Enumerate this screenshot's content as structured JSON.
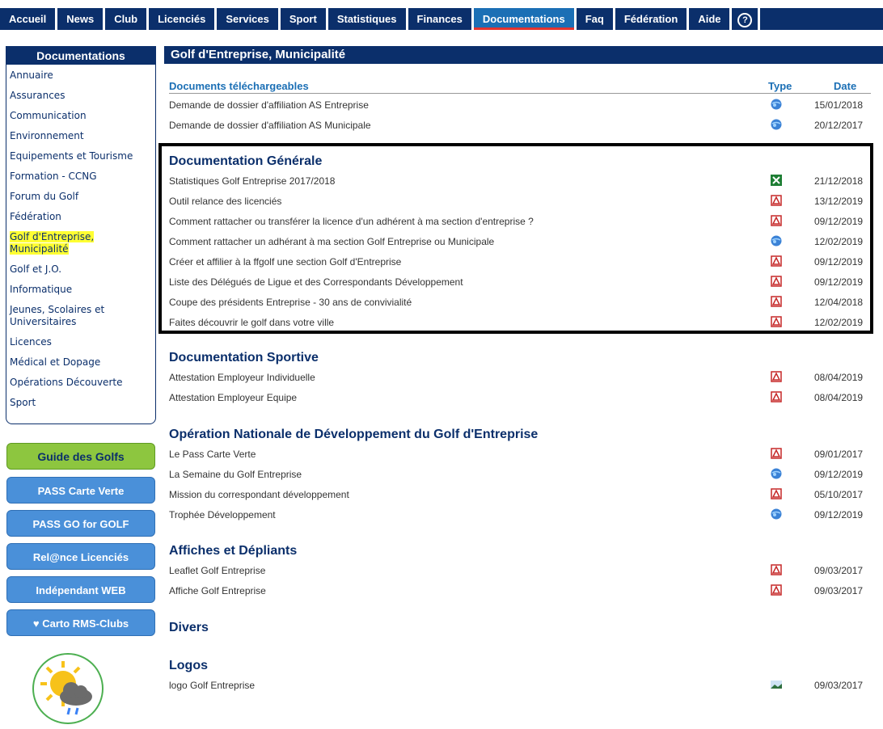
{
  "nav": {
    "items": [
      "Accueil",
      "News",
      "Club",
      "Licenciés",
      "Services",
      "Sport",
      "Statistiques",
      "Finances",
      "Documentations",
      "Faq",
      "Fédération",
      "Aide"
    ],
    "active_index": 8,
    "help_glyph": "?"
  },
  "sidebar": {
    "title": "Documentations",
    "items": [
      "Annuaire",
      "Assurances",
      "Communication",
      "Environnement",
      "Equipements et Tourisme",
      "Formation - CCNG",
      "Forum du Golf",
      "Fédération",
      "Golf d'Entreprise, Municipalité",
      "Golf et J.O.",
      "Informatique",
      "Jeunes, Scolaires et Universitaires",
      "Licences",
      "Médical et Dopage",
      "Opérations Découverte",
      "Sport"
    ],
    "highlighted_index": 8,
    "buttons": [
      "Guide des Golfs",
      "PASS Carte Verte",
      "PASS GO for GOLF",
      "Rel@nce Licenciés",
      "Indépendant WEB",
      "♥ Carto RMS-Clubs"
    ]
  },
  "main": {
    "title": "Golf d'Entreprise, Municipalité",
    "columns": {
      "title": "Documents téléchargeables",
      "type": "Type",
      "date": "Date"
    },
    "downloads": [
      {
        "label": "Demande de dossier d'affiliation AS Entreprise",
        "type": "web",
        "date": "15/01/2018"
      },
      {
        "label": "Demande de dossier d'affiliation AS Municipale",
        "type": "web",
        "date": "20/12/2017"
      }
    ],
    "sections": [
      {
        "title": "Documentation Générale",
        "rows": [
          {
            "label": "Statistiques Golf Entreprise 2017/2018",
            "type": "excel",
            "date": "21/12/2018"
          },
          {
            "label": "Outil relance des licenciés",
            "type": "pdf",
            "date": "13/12/2019"
          },
          {
            "label": "Comment rattacher ou transférer la licence d'un adhérent à ma section d'entreprise ?",
            "type": "pdf",
            "date": "09/12/2019"
          },
          {
            "label": "Comment rattacher un adhérant à ma section Golf Entreprise ou Municipale",
            "type": "web",
            "date": "12/02/2019"
          },
          {
            "label": "Créer et affilier à la ffgolf une section Golf d'Entreprise",
            "type": "pdf",
            "date": "09/12/2019"
          },
          {
            "label": "Liste des Délégués de Ligue et des Correspondants Développement",
            "type": "pdf",
            "date": "09/12/2019"
          },
          {
            "label": "Coupe des présidents Entreprise - 30 ans de convivialité",
            "type": "pdf",
            "date": "12/04/2018"
          },
          {
            "label": "Faites découvrir le golf dans votre ville",
            "type": "pdf",
            "date": "12/02/2019"
          }
        ]
      },
      {
        "title": "Documentation Sportive",
        "rows": [
          {
            "label": "Attestation Employeur Individuelle",
            "type": "pdf",
            "date": "08/04/2019"
          },
          {
            "label": "Attestation Employeur Equipe",
            "type": "pdf",
            "date": "08/04/2019"
          }
        ]
      },
      {
        "title": "Opération Nationale de Développement du Golf d'Entreprise",
        "rows": [
          {
            "label": "Le Pass Carte Verte",
            "type": "pdf",
            "date": "09/01/2017"
          },
          {
            "label": "La Semaine du Golf Entreprise",
            "type": "web",
            "date": "09/12/2019"
          },
          {
            "label": "Mission du correspondant développement",
            "type": "pdf",
            "date": "05/10/2017"
          },
          {
            "label": "Trophée Développement",
            "type": "web",
            "date": "09/12/2019"
          }
        ]
      },
      {
        "title": "Affiches et Dépliants",
        "rows": [
          {
            "label": "Leaflet Golf Entreprise",
            "type": "pdf",
            "date": "09/03/2017"
          },
          {
            "label": "Affiche Golf Entreprise",
            "type": "pdf",
            "date": "09/03/2017"
          }
        ]
      },
      {
        "title": "Divers",
        "rows": []
      },
      {
        "title": "Logos",
        "rows": [
          {
            "label": "logo Golf Entreprise",
            "type": "image",
            "date": "09/03/2017"
          }
        ]
      }
    ]
  },
  "colors": {
    "navy": "#0b2f6b",
    "active": "#1b6fb5",
    "highlight": "#ffff33"
  }
}
